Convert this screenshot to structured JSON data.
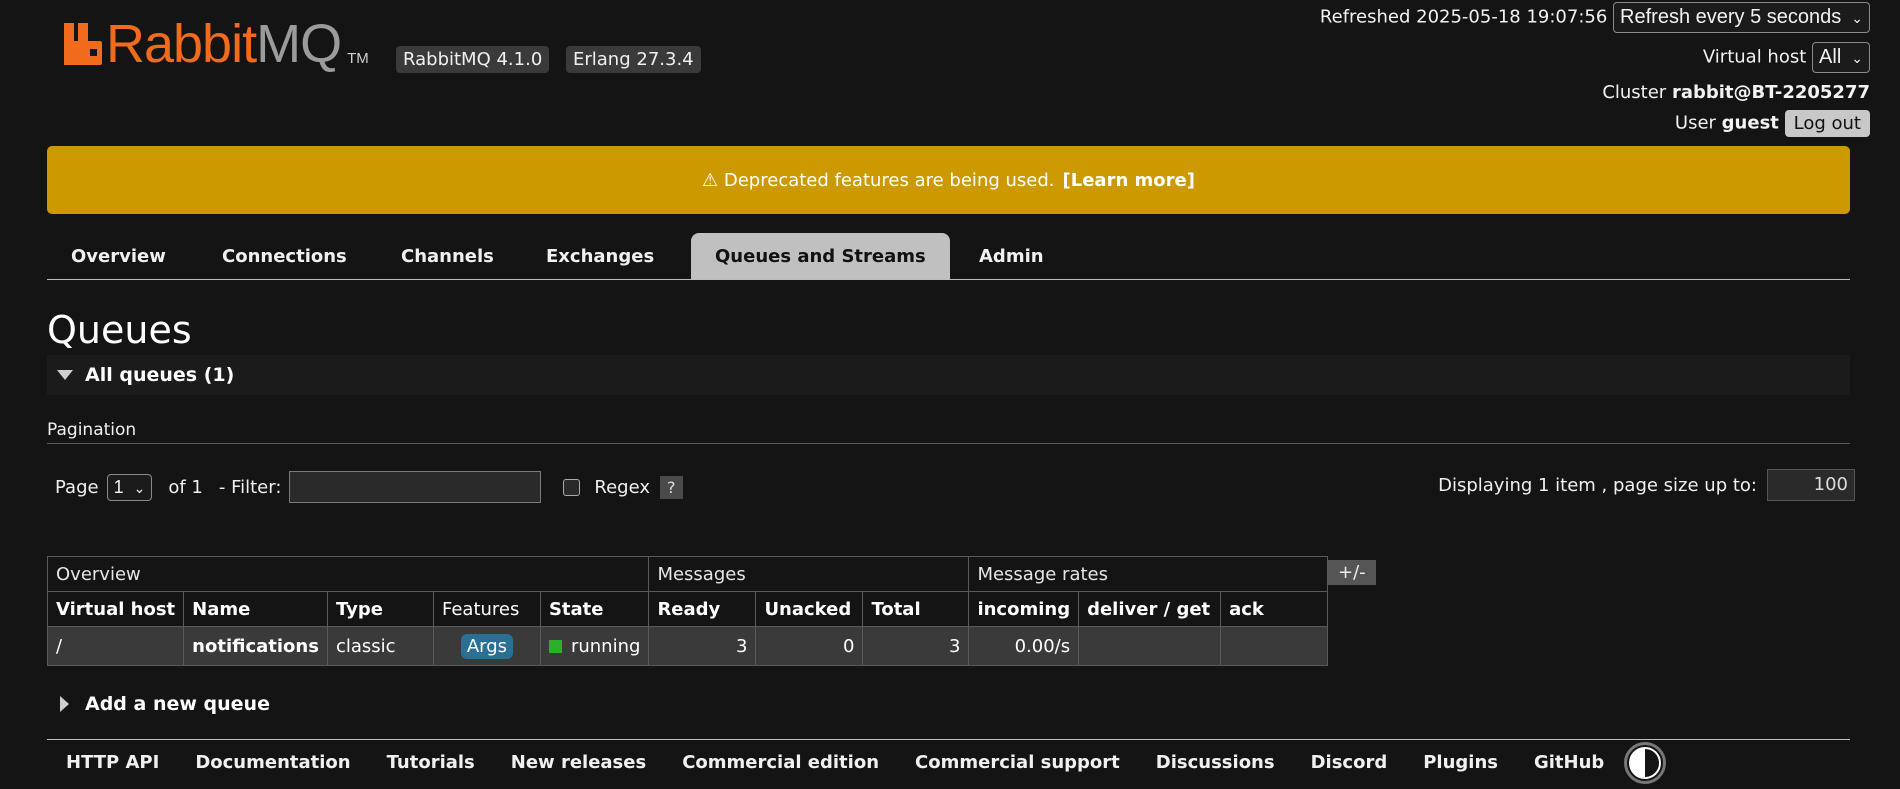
{
  "brand": {
    "rabbit": "Rabbit",
    "mq": "MQ",
    "tm": "TM"
  },
  "versions": {
    "rabbitmq": "RabbitMQ 4.1.0",
    "erlang": "Erlang 27.3.4"
  },
  "header": {
    "refreshed": "Refreshed 2025-05-18 19:07:56",
    "refresh_select": "Refresh every 5 seconds",
    "vhost_label": "Virtual host",
    "vhost_select": "All",
    "cluster_label": "Cluster",
    "cluster_name": "rabbit@BT-2205277",
    "user_label": "User",
    "user_name": "guest",
    "logout": "Log out"
  },
  "banner": {
    "text": "⚠ Deprecated features are being used.",
    "link": "[Learn more]",
    "color": "#cc9900"
  },
  "tabs": [
    "Overview",
    "Connections",
    "Channels",
    "Exchanges",
    "Queues and Streams",
    "Admin"
  ],
  "active_tab": "Queues and Streams",
  "page_title": "Queues",
  "section_title": "All queues (1)",
  "pagination": {
    "label": "Pagination",
    "page_label": "Page",
    "page_value": "1",
    "of_label": "of 1",
    "filter_label": "- Filter:",
    "filter_value": "",
    "regex_label": "Regex",
    "regex_checked": false,
    "help": "?",
    "displaying": "Displaying 1 item , page size up to:",
    "page_size": "100"
  },
  "table": {
    "groups": [
      "Overview",
      "Messages",
      "Message rates"
    ],
    "columns": [
      "Virtual host",
      "Name",
      "Type",
      "Features",
      "State",
      "Ready",
      "Unacked",
      "Total",
      "incoming",
      "deliver / get",
      "ack"
    ],
    "row": {
      "vhost": "/",
      "name": "notifications",
      "type": "classic",
      "features": "Args",
      "state": "running",
      "ready": "3",
      "unacked": "0",
      "total": "3",
      "incoming": "0.00/s",
      "deliver_get": "",
      "ack": ""
    },
    "toggle_columns": "+/-"
  },
  "add_queue": "Add a new queue",
  "footer": [
    "HTTP API",
    "Documentation",
    "Tutorials",
    "New releases",
    "Commercial edition",
    "Commercial support",
    "Discussions",
    "Discord",
    "Plugins",
    "GitHub"
  ]
}
